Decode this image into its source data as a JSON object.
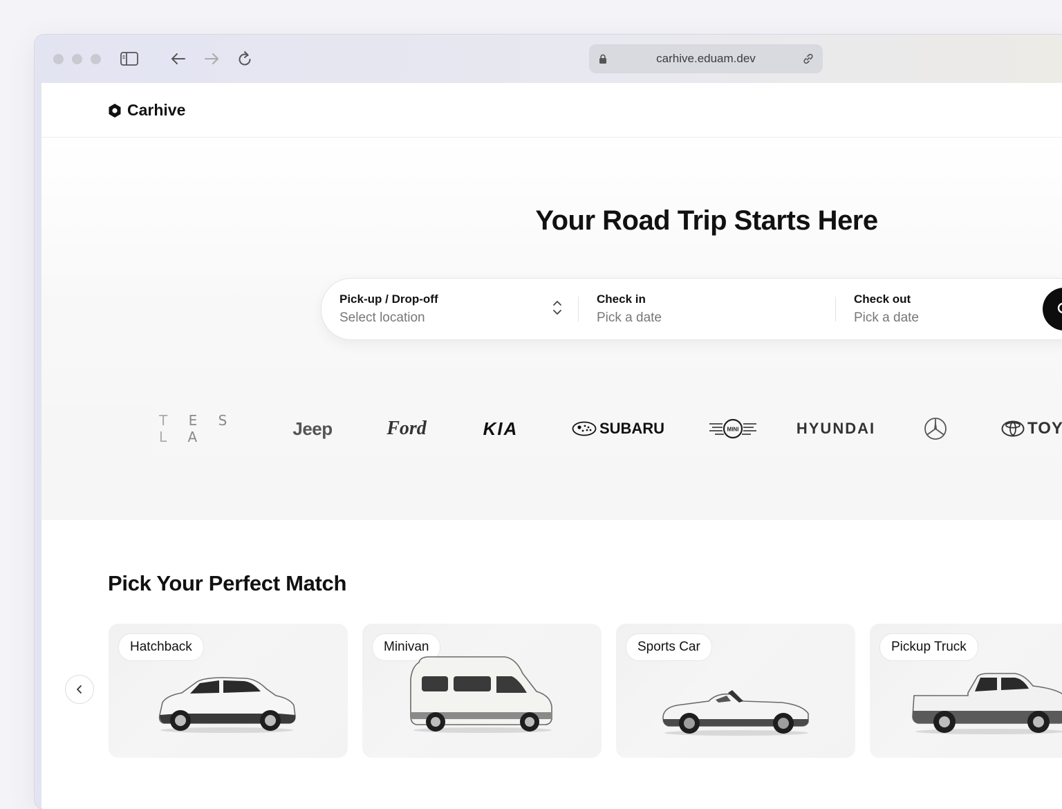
{
  "browser": {
    "url": "carhive.eduam.dev"
  },
  "nav": {
    "brand": "Carhive"
  },
  "hero": {
    "title": "Your Road Trip Starts Here",
    "search": {
      "location_label": "Pick-up / Drop-off",
      "location_value": "Select location",
      "checkin_label": "Check in",
      "checkin_value": "Pick a date",
      "checkout_label": "Check out",
      "checkout_value": "Pick a date"
    }
  },
  "brands": [
    "TESLA",
    "Jeep",
    "Ford",
    "KIA",
    "SUBARU",
    "MINI",
    "HYUNDAI",
    "Mercedes-Benz",
    "TOYOTA"
  ],
  "brand_labels": {
    "tesla": "T E S L A",
    "jeep": "Jeep",
    "ford": "Ford",
    "kia": "KIA",
    "subaru": "SUBARU",
    "mini": "MINI",
    "hyundai": "HYUNDAI",
    "toyota": "TOY"
  },
  "categories": {
    "title": "Pick Your Perfect Match",
    "items": [
      {
        "label": "Hatchback"
      },
      {
        "label": "Minivan"
      },
      {
        "label": "Sports Car"
      },
      {
        "label": "Pickup Truck"
      }
    ]
  },
  "icons": {
    "sidebar": "sidebar-icon",
    "back": "arrow-left-icon",
    "forward": "arrow-right-icon",
    "reload": "reload-icon",
    "lock": "lock-icon",
    "link": "link-icon",
    "search": "search-icon",
    "prev": "chevron-left-icon"
  },
  "colors": {
    "accent": "#0d0d0d",
    "muted_text": "#777777",
    "card_bg": "#f3f3f3"
  }
}
